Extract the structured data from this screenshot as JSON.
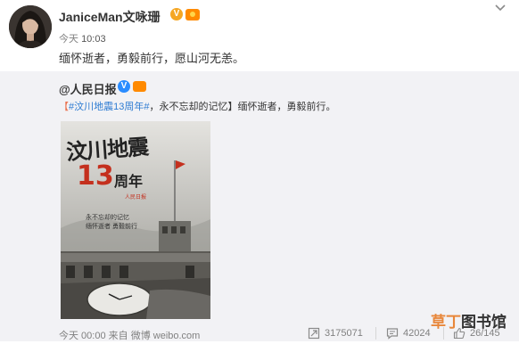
{
  "post": {
    "author": "JaniceMan文咏珊",
    "time_day": "今天",
    "time_clock": "10:03",
    "text": "缅怀逝者，勇毅前行，愿山河无恙。"
  },
  "repost": {
    "author": "@人民日报",
    "text_bracket_open": "【",
    "text_hashtag": "#汶川地震13周年#",
    "text_rest": "，永不忘却的记忆】缅怀逝者，勇毅前行。",
    "poster": {
      "title": "汶川地震",
      "year": "13",
      "year_suffix": "周年",
      "brand": "人民日报",
      "sub1": "永不忘却的记忆",
      "sub2": "缅怀逝者  勇毅前行"
    },
    "footer": {
      "time": "今天 00:00 来自 微博 weibo.com",
      "reposts": "3175071",
      "comments": "42024",
      "likes": "26/145"
    }
  },
  "watermark": {
    "part1": "草丁",
    "part2": "图书馆"
  },
  "colors": {
    "accent_orange": "#eb7350",
    "link_blue": "#2d7bd2",
    "repost_bg": "#f2f2f5"
  },
  "icons": [
    "chevron-down-icon",
    "verified-badge-icon",
    "medal-icon",
    "repost-icon",
    "comment-icon",
    "like-icon"
  ]
}
